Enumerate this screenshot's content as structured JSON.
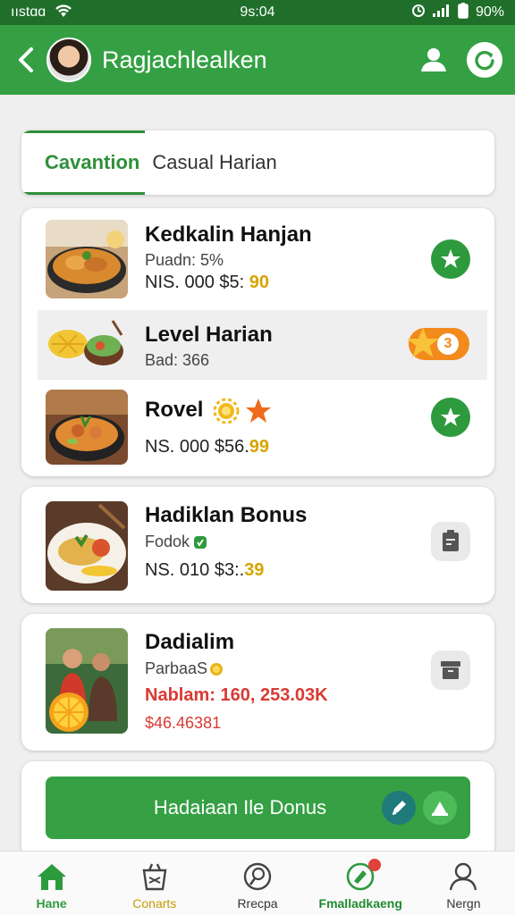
{
  "status_bar": {
    "carrier": "ııstɑɑ",
    "time": "9s:04",
    "battery": "90%"
  },
  "header": {
    "title": "Ragjachlealken"
  },
  "tabs": [
    {
      "label": "Cavantion",
      "active": true
    },
    {
      "label": "Casual Harian",
      "active": false
    }
  ],
  "items": [
    {
      "title": "Kedkalin Hanjan",
      "sub": "Puadn: 5%",
      "price": "NIS. 000 $5:",
      "price_accent": "90",
      "action_icon": "star-icon"
    },
    {
      "title": "Level Harian",
      "sub": "Bad: 366",
      "badge": "3",
      "action_icon": "star-badge-icon"
    },
    {
      "title": "Rovel",
      "price": "NS. 000 $56.",
      "price_accent": "99",
      "action_icon": "star-icon"
    },
    {
      "title": "Hadiklan Bonus",
      "sub": "Fodok",
      "price": "NS. 010 $3:.",
      "price_accent": "39",
      "action_icon": "clipboard-icon"
    },
    {
      "title": "Dadialim",
      "sub": "ParbaaS",
      "stat": "Nablam: 160, 253.03K",
      "money": "$46.46381",
      "action_icon": "archive-icon"
    }
  ],
  "action": {
    "button_label": "Hadaiaan Ile Donus"
  },
  "bottom_nav": [
    {
      "label": "Hane",
      "icon": "home-icon"
    },
    {
      "label": "Conarts",
      "icon": "basket-icon"
    },
    {
      "label": "Rrecpa",
      "icon": "search-icon"
    },
    {
      "label": "Fmalladkaeng",
      "icon": "favorites-icon"
    },
    {
      "label": "Nergn",
      "icon": "user-icon"
    }
  ],
  "colors": {
    "primary": "#34a043",
    "primary_dark": "#1f6e2a",
    "accent": "#d8a300",
    "danger": "#d93a33"
  }
}
